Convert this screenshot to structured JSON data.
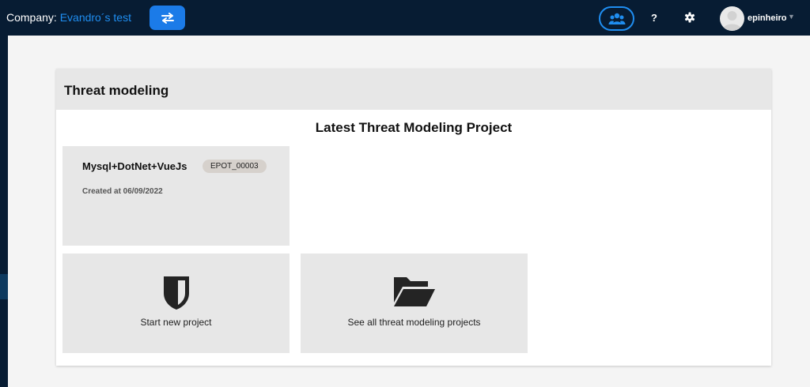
{
  "header": {
    "company_label": "Company:",
    "company_name": "Evandro´s test",
    "help_label": "?",
    "username": "epinheiro",
    "accent_color": "#1f8ef1",
    "bar_color": "#071c33"
  },
  "icons": {
    "swap": "swap-arrows-icon",
    "team": "users-icon",
    "settings": "gear-icon",
    "avatar": "user-avatar",
    "new_project": "shield-icon",
    "all_projects": "folder-open-icon"
  },
  "card": {
    "title": "Threat modeling",
    "section_title": "Latest Threat Modeling Project"
  },
  "latest_project": {
    "name": "Mysql+DotNet+VueJs",
    "code": "EPOT_00003",
    "created": "Created at 06/09/2022"
  },
  "actions": {
    "new_project_label": "Start new project",
    "all_projects_label": "See all threat modeling projects"
  }
}
